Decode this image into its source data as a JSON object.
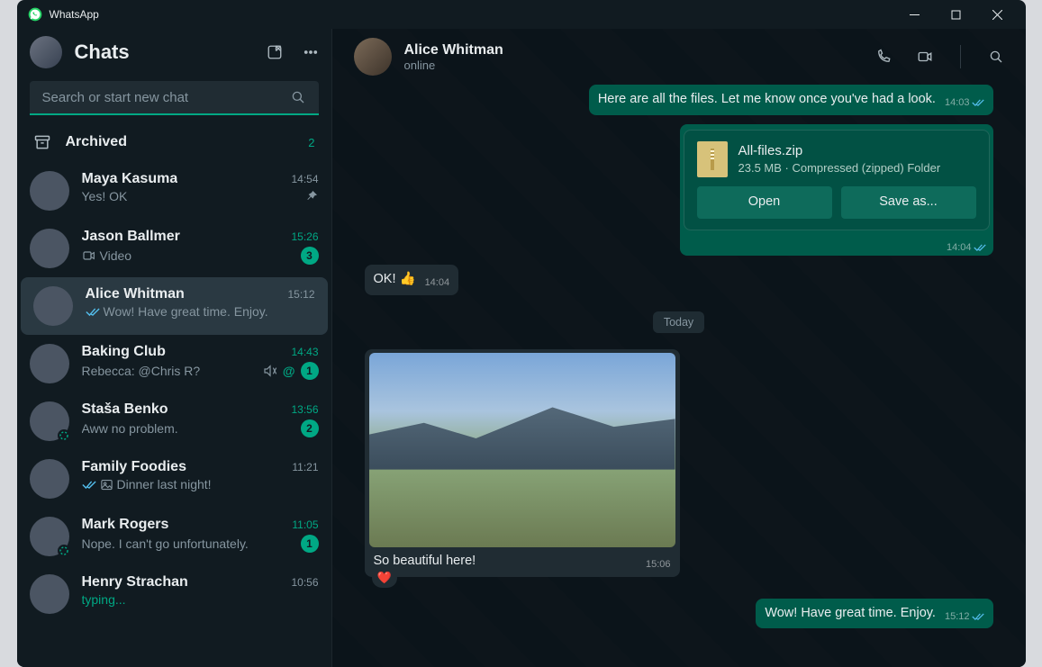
{
  "app": {
    "title": "WhatsApp"
  },
  "sidebar": {
    "title": "Chats",
    "search_placeholder": "Search or start new chat",
    "archived": {
      "label": "Archived",
      "count": "2"
    },
    "chats": [
      {
        "name": "Maya Kasuma",
        "time": "14:54",
        "preview": "Yes! OK",
        "pinned": true
      },
      {
        "name": "Jason Ballmer",
        "time": "15:26",
        "preview": "Video",
        "video": true,
        "unread": "3",
        "time_unread": true
      },
      {
        "name": "Alice Whitman",
        "time": "15:12",
        "preview": "Wow! Have great time. Enjoy.",
        "checks": true,
        "selected": true
      },
      {
        "name": "Baking Club",
        "time": "14:43",
        "preview": "Rebecca: @Chris R?",
        "muted": true,
        "mention": true,
        "unread": "1",
        "time_unread": true
      },
      {
        "name": "Staša Benko",
        "time": "13:56",
        "preview": "Aww no problem.",
        "unread": "2",
        "time_unread": true,
        "status": true
      },
      {
        "name": "Family Foodies",
        "time": "11:21",
        "preview": "Dinner last night!",
        "checks": true,
        "photo": true,
        "group_green": true
      },
      {
        "name": "Mark Rogers",
        "time": "11:05",
        "preview": "Nope. I can't go unfortunately.",
        "unread": "1",
        "time_unread": true,
        "status": true
      },
      {
        "name": "Henry Strachan",
        "time": "10:56",
        "preview": "typing...",
        "typing": true
      }
    ]
  },
  "chat": {
    "name": "Alice Whitman",
    "status": "online",
    "msg_text1": "Here are all the files. Let me know once you've had a look.",
    "msg_text1_time": "14:03",
    "file": {
      "name": "All-files.zip",
      "meta": "23.5 MB · Compressed (zipped) Folder",
      "open": "Open",
      "save": "Save as...",
      "time": "14:04"
    },
    "msg_in1": "OK! 👍",
    "msg_in1_time": "14:04",
    "day": "Today",
    "img_caption": "So beautiful here!",
    "img_time": "15:06",
    "msg_out2": "Wow! Have great time. Enjoy.",
    "msg_out2_time": "15:12"
  }
}
